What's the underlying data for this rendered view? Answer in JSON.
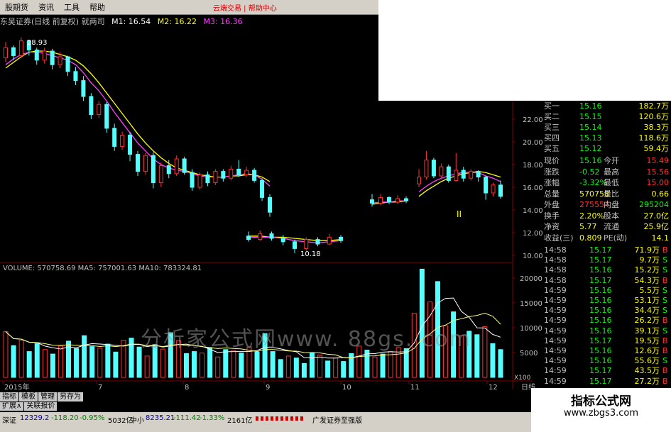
{
  "menu": [
    "股期货",
    "资讯",
    "工具",
    "帮助"
  ],
  "menu_red": "云端交易 | 帮助中心",
  "title": {
    "name": "东吴证券(日线 前复权) 就两司",
    "m1": "M1: 16.54",
    "m2": "M2: 16.22",
    "m3": "M3: 16.36"
  },
  "colors": {
    "up": "#ff3030",
    "down": "#54ffff",
    "ma1": "#ffffff",
    "ma2": "#ffff00",
    "ma3": "#ff40ff",
    "grid": "#800000"
  },
  "price_labels": {
    "high": "28.93",
    "low": "10.18",
    "marker": "II"
  },
  "chart_data": {
    "type": "candlestick",
    "ylim": [
      9.5,
      30
    ],
    "yticks": [
      10.0,
      12.0,
      14.0,
      16.0,
      18.0,
      20.0,
      22.0
    ],
    "x_labels": [
      "2015年",
      "7",
      "8",
      "9",
      "10",
      "11",
      "12"
    ],
    "candles": [
      [
        27.4,
        28.3,
        28.8,
        27.0
      ],
      [
        28.3,
        27.6,
        28.5,
        27.2
      ],
      [
        27.6,
        28.9,
        29.2,
        27.4
      ],
      [
        28.9,
        28.1,
        29.0,
        27.6
      ],
      [
        28.1,
        27.2,
        28.3,
        26.8
      ],
      [
        27.2,
        28.0,
        28.3,
        26.9
      ],
      [
        28.0,
        26.8,
        28.2,
        26.4
      ],
      [
        26.8,
        27.5,
        27.9,
        26.5
      ],
      [
        27.5,
        26.2,
        27.6,
        25.8
      ],
      [
        26.2,
        25.4,
        26.6,
        25.0
      ],
      [
        25.4,
        24.0,
        25.8,
        23.6
      ],
      [
        24.0,
        22.4,
        24.3,
        22.0
      ],
      [
        22.4,
        23.3,
        23.6,
        22.1
      ],
      [
        23.3,
        21.2,
        23.5,
        20.8
      ],
      [
        21.2,
        19.6,
        21.6,
        19.2
      ],
      [
        19.6,
        20.6,
        20.9,
        19.3
      ],
      [
        20.6,
        18.9,
        20.9,
        18.3
      ],
      [
        18.9,
        17.4,
        19.2,
        17.0
      ],
      [
        17.4,
        18.8,
        19.0,
        17.1
      ],
      [
        18.8,
        16.4,
        19.1,
        15.9
      ],
      [
        16.4,
        17.9,
        18.2,
        16.0
      ],
      [
        17.9,
        17.2,
        18.4,
        16.8
      ],
      [
        17.2,
        18.5,
        18.8,
        17.0
      ],
      [
        18.5,
        17.3,
        18.7,
        17.1
      ],
      [
        17.3,
        16.0,
        17.6,
        15.7
      ],
      [
        16.0,
        17.1,
        17.3,
        15.8
      ],
      [
        17.1,
        16.4,
        17.4,
        16.1
      ],
      [
        16.4,
        17.4,
        17.6,
        16.2
      ],
      [
        17.4,
        16.8,
        17.6,
        16.5
      ],
      [
        16.8,
        17.6,
        17.9,
        16.6
      ],
      [
        17.6,
        17.1,
        18.4,
        16.9
      ],
      [
        17.1,
        17.5,
        17.8,
        16.9
      ],
      [
        17.5,
        16.6,
        17.7,
        16.4
      ],
      [
        16.6,
        15.1,
        16.8,
        14.8
      ],
      [
        15.1,
        13.8,
        15.4,
        13.4
      ],
      [
        11.7,
        11.4,
        12.1,
        11.2
      ],
      [
        11.4,
        11.9,
        12.2,
        11.3
      ],
      [
        11.9,
        11.5,
        12.1,
        11.3
      ],
      [
        11.5,
        11.2,
        11.8,
        10.9
      ],
      [
        11.2,
        10.6,
        11.4,
        10.18
      ],
      [
        10.6,
        11.4,
        11.6,
        10.4
      ],
      [
        11.4,
        11.0,
        11.6,
        10.8
      ],
      [
        11.0,
        11.6,
        11.9,
        10.9
      ],
      [
        11.6,
        11.3,
        11.8,
        11.1
      ],
      [
        14.9,
        14.6,
        15.4,
        14.3
      ],
      [
        14.6,
        15.1,
        15.4,
        14.4
      ],
      [
        15.1,
        14.7,
        15.2,
        14.5
      ],
      [
        14.7,
        15.0,
        15.3,
        14.5
      ],
      [
        15.0,
        14.8,
        15.2,
        14.6
      ],
      [
        16.3,
        16.9,
        17.6,
        16.0
      ],
      [
        16.9,
        18.4,
        19.2,
        16.7
      ],
      [
        18.4,
        17.0,
        18.6,
        16.8
      ],
      [
        17.0,
        17.8,
        18.1,
        16.7
      ],
      [
        17.8,
        16.6,
        18.0,
        16.4
      ],
      [
        16.6,
        17.5,
        19.0,
        16.5
      ],
      [
        17.5,
        16.8,
        17.8,
        16.5
      ],
      [
        16.8,
        17.4,
        17.6,
        16.6
      ],
      [
        17.4,
        16.9,
        17.5,
        16.5
      ],
      [
        16.9,
        15.5,
        17.0,
        14.9
      ],
      [
        15.5,
        16.2,
        16.4,
        15.2
      ],
      [
        16.2,
        15.2,
        16.6,
        15.0
      ]
    ],
    "ma_short": [
      26.8,
      27.3,
      27.7,
      27.9,
      27.9,
      27.8,
      27.6,
      27.4,
      27.2,
      26.8,
      26.1,
      25.2,
      24.5,
      23.6,
      22.6,
      21.7,
      20.8,
      19.9,
      19.2,
      18.5,
      18.0,
      17.7,
      17.5,
      17.4,
      17.2,
      17.0,
      16.9,
      16.9,
      16.9,
      17.0,
      17.1,
      17.2,
      17.1,
      16.7,
      16.1,
      11.6,
      11.6,
      11.6,
      11.5,
      11.3,
      11.2,
      11.1,
      11.2,
      11.3,
      14.6,
      14.7,
      14.7,
      14.8,
      14.8,
      15.6,
      16.1,
      16.5,
      16.8,
      17.0,
      17.2,
      17.3,
      17.3,
      17.3,
      17.0,
      16.8,
      16.5
    ],
    "ma_long": [
      26.5,
      27.0,
      27.5,
      27.9,
      28.0,
      28.0,
      27.9,
      27.7,
      27.5,
      27.2,
      26.7,
      26.0,
      25.2,
      24.3,
      23.4,
      22.5,
      21.6,
      20.7,
      19.9,
      19.2,
      18.6,
      18.1,
      17.7,
      17.5,
      17.3,
      17.1,
      17.0,
      16.9,
      16.9,
      17.0,
      17.0,
      17.1,
      17.1,
      16.9,
      16.5,
      11.7,
      11.7,
      11.6,
      11.6,
      11.5,
      11.4,
      11.3,
      11.3,
      11.4,
      14.5,
      14.6,
      14.7,
      14.7,
      14.8,
      15.2,
      15.7,
      16.1,
      16.5,
      16.8,
      17.0,
      17.2,
      17.3,
      17.4,
      17.3,
      17.1,
      16.9
    ],
    "volume": {
      "header": "VOLUME: 570758.69 MA5: 757001.63 MA10: 783324.81",
      "ylim": [
        0,
        22000
      ],
      "yticks": [
        5000,
        10000,
        15000,
        20000
      ],
      "bottom_label": "X100",
      "values": [
        9200,
        6400,
        7500,
        5200,
        6800,
        5600,
        4700,
        6300,
        7300,
        5800,
        8400,
        6200,
        5900,
        6700,
        5100,
        7500,
        7900,
        6100,
        4300,
        6600,
        5700,
        9000,
        7400,
        4800,
        5200,
        4900,
        6000,
        4100,
        5600,
        5400,
        4900,
        6100,
        5100,
        8800,
        5200,
        3600,
        4300,
        3900,
        2800,
        5000,
        4500,
        3300,
        3900,
        3200,
        4800,
        6300,
        5500,
        4100,
        4700,
        5200,
        6000,
        5800,
        12900,
        21800,
        15200,
        19300,
        10400,
        13200,
        8400,
        9300,
        8600,
        10200,
        6800,
        5600
      ],
      "up_flags": [
        1,
        0,
        1,
        0,
        0,
        1,
        0,
        1,
        0,
        0,
        0,
        0,
        1,
        0,
        0,
        1,
        0,
        0,
        1,
        0,
        1,
        0,
        1,
        0,
        0,
        1,
        0,
        1,
        0,
        1,
        0,
        1,
        0,
        0,
        0,
        0,
        1,
        0,
        0,
        0,
        1,
        0,
        1,
        0,
        0,
        1,
        0,
        1,
        0,
        1,
        1,
        0,
        1,
        0,
        1,
        0,
        1,
        0,
        1,
        0,
        0,
        1,
        0,
        0
      ]
    }
  },
  "quote_panel": {
    "bids": [
      {
        "label": "买一",
        "price": "15.16",
        "vol": "182.7万"
      },
      {
        "label": "买二",
        "price": "15.15",
        "vol": "120.6万"
      },
      {
        "label": "买三",
        "price": "15.14",
        "vol": "38.3万"
      },
      {
        "label": "买四",
        "price": "15.13",
        "vol": "118.6万"
      },
      {
        "label": "买五",
        "price": "15.12",
        "vol": "59.4万"
      }
    ],
    "stats": [
      [
        "现价",
        "15.16",
        "今开",
        "15.49"
      ],
      [
        "涨跌",
        "-0.52",
        "最高",
        "15.56"
      ],
      [
        "涨幅",
        "-3.32%",
        "最低",
        "15.00"
      ],
      [
        "总量",
        "570758",
        "量比",
        "0.66"
      ],
      [
        "外盘",
        "275554",
        "内盘",
        "295204"
      ],
      [
        "换手",
        "2.20%",
        "股本",
        "27.0亿"
      ],
      [
        "净资",
        "5.77",
        "流通",
        "25.9亿"
      ],
      [
        "收益(三)",
        "0.809",
        "PE(动)",
        "14.1"
      ]
    ],
    "ticks": [
      [
        "14:58",
        "15.17",
        "71.9万",
        "B"
      ],
      [
        "14:58",
        "15.17",
        "9.7万",
        "S"
      ],
      [
        "14:58",
        "15.16",
        "15.2万",
        "S"
      ],
      [
        "14:58",
        "15.17",
        "54.3万",
        "B"
      ],
      [
        "14:59",
        "15.16",
        "5.5万",
        "S"
      ],
      [
        "14:59",
        "15.16",
        "53.1万",
        "S"
      ],
      [
        "14:59",
        "15.16",
        "34.4万",
        "S"
      ],
      [
        "14:59",
        "15.16",
        "26.2万",
        "B"
      ],
      [
        "14:59",
        "15.16",
        "39.1万",
        "S"
      ],
      [
        "14:59",
        "15.17",
        "19.5万",
        "B"
      ],
      [
        "14:59",
        "15.16",
        "12.6万",
        "B"
      ],
      [
        "14:59",
        "15.16",
        "55.6万",
        "S"
      ],
      [
        "14:59",
        "15.17",
        "43.5万",
        "B"
      ],
      [
        "14:59",
        "15.17",
        "27.2万",
        "B"
      ]
    ]
  },
  "tabs_row1": [
    "指标",
    "模板",
    "管理",
    "另存为"
  ],
  "tabs_row2": [
    "扩展∧",
    "关联报价"
  ],
  "status": {
    "szzs_label": "深证",
    "szzs_value": "12329.2",
    "szzs_chg": "-118.20",
    "szzs_pct": "-0.95%",
    "szzs_amt": "5032亿",
    "zx_label": "中小",
    "zx_value": "8235.21",
    "zx_chg": "-111.42",
    "zx_pct": "-1.33%",
    "zx_amt": "2161亿",
    "news": "广发证券至强版"
  },
  "watermark": "分析家公式网www. 88gs. com",
  "brand": {
    "title": "指标公式网",
    "url": "www.zbgs3.com"
  },
  "right_edge_label": "日线"
}
